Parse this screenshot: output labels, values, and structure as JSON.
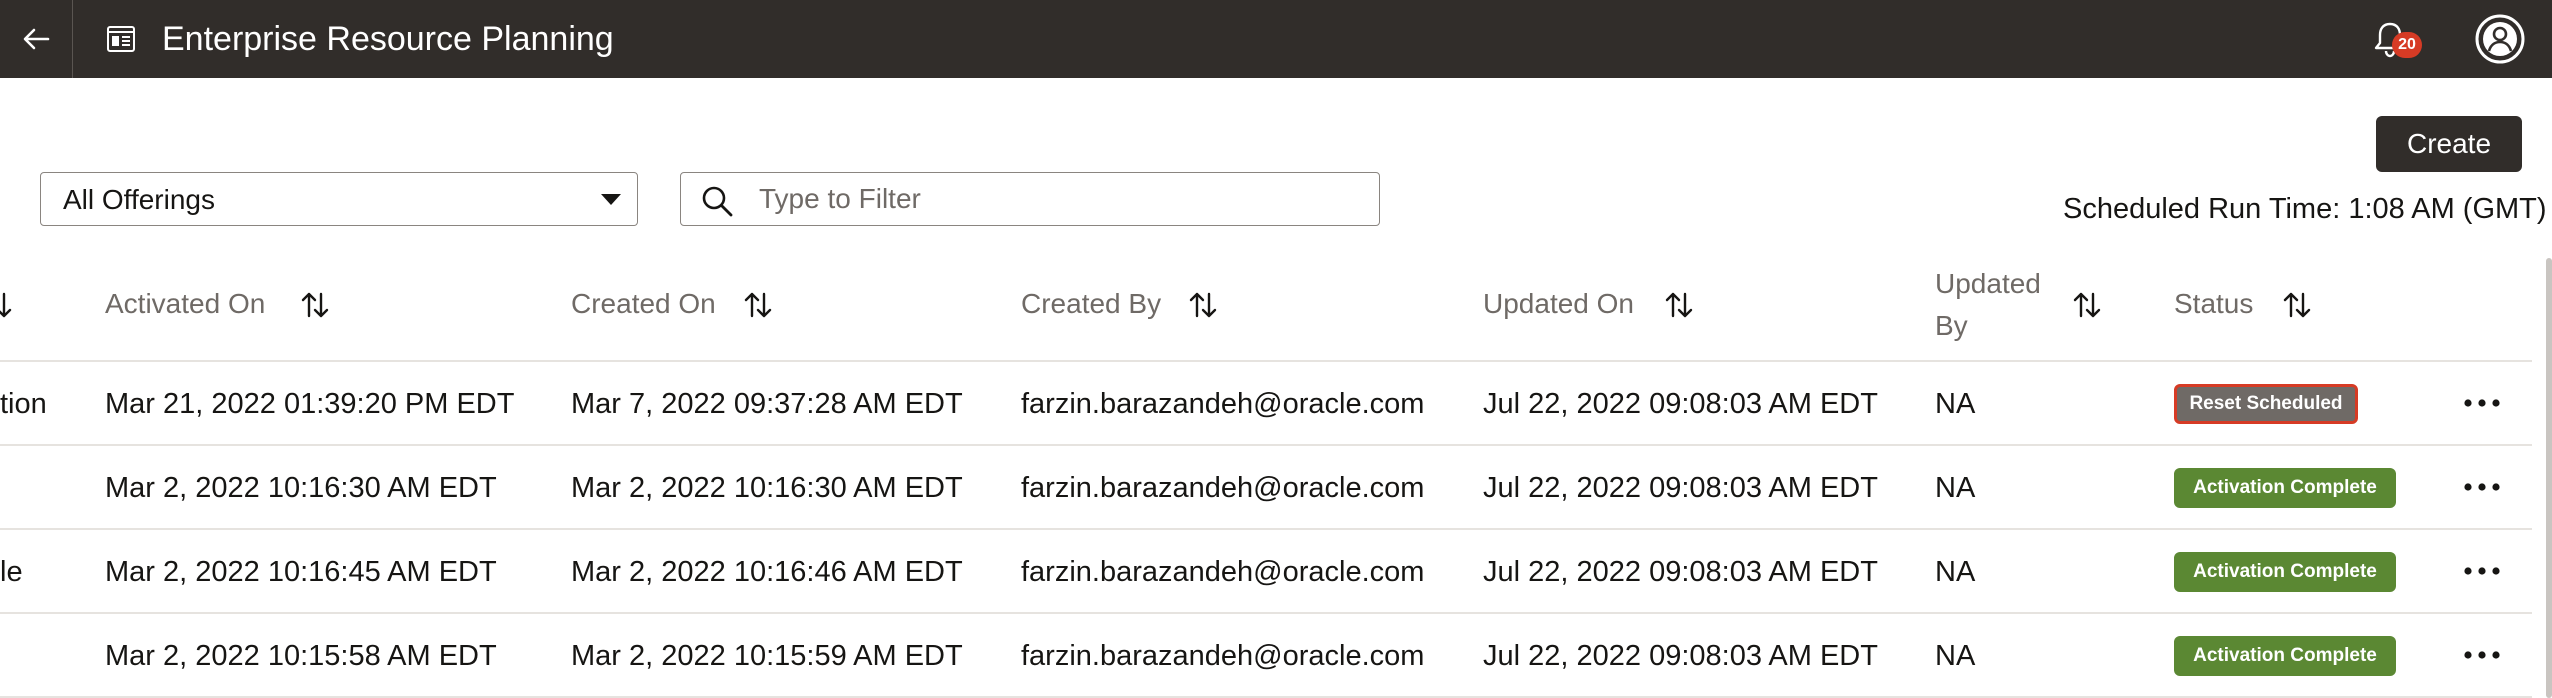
{
  "app": {
    "title": "Enterprise Resource Planning",
    "notification_count": "20"
  },
  "toolbar": {
    "create_label": "Create",
    "offerings_selected": "All Offerings",
    "filter_placeholder": "Type to Filter",
    "scheduled_run_time": "Scheduled Run Time: 1:08 AM (GMT)"
  },
  "table": {
    "columns": {
      "activated_on": "Activated On",
      "created_on": "Created On",
      "created_by": "Created By",
      "updated_on": "Updated On",
      "updated_by_line1": "Updated",
      "updated_by_line2": "By",
      "status": "Status"
    },
    "rows": [
      {
        "name_fragment": "tion",
        "activated_on": "Mar 21, 2022 01:39:20 PM EDT",
        "created_on": "Mar 7, 2022 09:37:28 AM EDT",
        "created_by": "farzin.barazandeh@oracle.com",
        "updated_on": "Jul 22, 2022 09:08:03 AM EDT",
        "updated_by": "NA",
        "status": "Reset Scheduled"
      },
      {
        "name_fragment": "",
        "activated_on": "Mar 2, 2022 10:16:30 AM EDT",
        "created_on": "Mar 2, 2022 10:16:30 AM EDT",
        "created_by": "farzin.barazandeh@oracle.com",
        "updated_on": "Jul 22, 2022 09:08:03 AM EDT",
        "updated_by": "NA",
        "status": "Activation Complete"
      },
      {
        "name_fragment": "le",
        "activated_on": "Mar 2, 2022 10:16:45 AM EDT",
        "created_on": "Mar 2, 2022 10:16:46 AM EDT",
        "created_by": "farzin.barazandeh@oracle.com",
        "updated_on": "Jul 22, 2022 09:08:03 AM EDT",
        "updated_by": "NA",
        "status": "Activation Complete"
      },
      {
        "name_fragment": "",
        "activated_on": "Mar 2, 2022 10:15:58 AM EDT",
        "created_on": "Mar 2, 2022 10:15:59 AM EDT",
        "created_by": "farzin.barazandeh@oracle.com",
        "updated_on": "Jul 22, 2022 09:08:03 AM EDT",
        "updated_by": "NA",
        "status": "Activation Complete"
      }
    ]
  },
  "colors": {
    "header_bg": "#312d2a",
    "status_complete": "#5b8833",
    "status_reset": "#6f6a66",
    "focus_ring": "#d63b25",
    "badge_red": "#d63b25"
  },
  "icons": [
    "back-arrow-icon",
    "app-page-icon",
    "bell-icon",
    "user-avatar-icon",
    "chevron-down-icon",
    "search-icon",
    "sort-icon",
    "more-options-icon"
  ]
}
